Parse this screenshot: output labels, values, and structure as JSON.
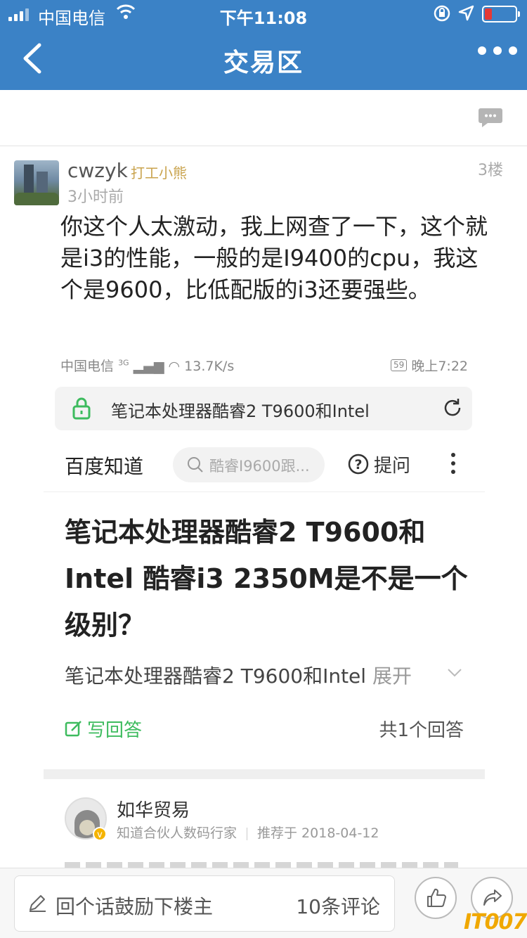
{
  "status_bar": {
    "carrier": "中国电信",
    "time": "下午11:08"
  },
  "nav": {
    "title": "交易区"
  },
  "post": {
    "username": "cwzyk",
    "user_badge": "打工小熊",
    "time": "3小时前",
    "floor": "3楼",
    "content": "你这个人太激动，我上网查了一下，这个就是i3的性能，一般的是I9400的cpu，我这个是9600，比低配版的i3还要强些。"
  },
  "embedded": {
    "status": {
      "carrier": "中国电信",
      "signal_tag": "3G",
      "speed": "13.7K/s",
      "battery": "59",
      "time": "晚上7:22"
    },
    "url_bar": {
      "text": "笔记本处理器酷睿2 T9600和Intel"
    },
    "header": {
      "logo": "百度知道",
      "search_placeholder": "酷睿I9600跟...",
      "ask_label": "提问"
    },
    "question": {
      "title": "笔记本处理器酷睿2 T9600和Intel 酷睿i3 2350M是不是一个级别？",
      "desc": "笔记本处理器酷睿2 T9600和Intel",
      "expand": "展开",
      "write_answer": "写回答",
      "answer_count": "共1个回答"
    },
    "answer": {
      "author": "如华贸易",
      "role": "知道合伙人数码行家",
      "recommended": "推荐于 2018-04-12"
    }
  },
  "bottom_bar": {
    "reply_placeholder": "回个话鼓励下楼主",
    "comment_count": "10条评论"
  },
  "watermark": "IT007",
  "colors": {
    "nav_bg": "#3b82c6",
    "badge": "#c9a34d",
    "zhidao_green": "#3dbb5e",
    "watermark": "#f0a800"
  }
}
